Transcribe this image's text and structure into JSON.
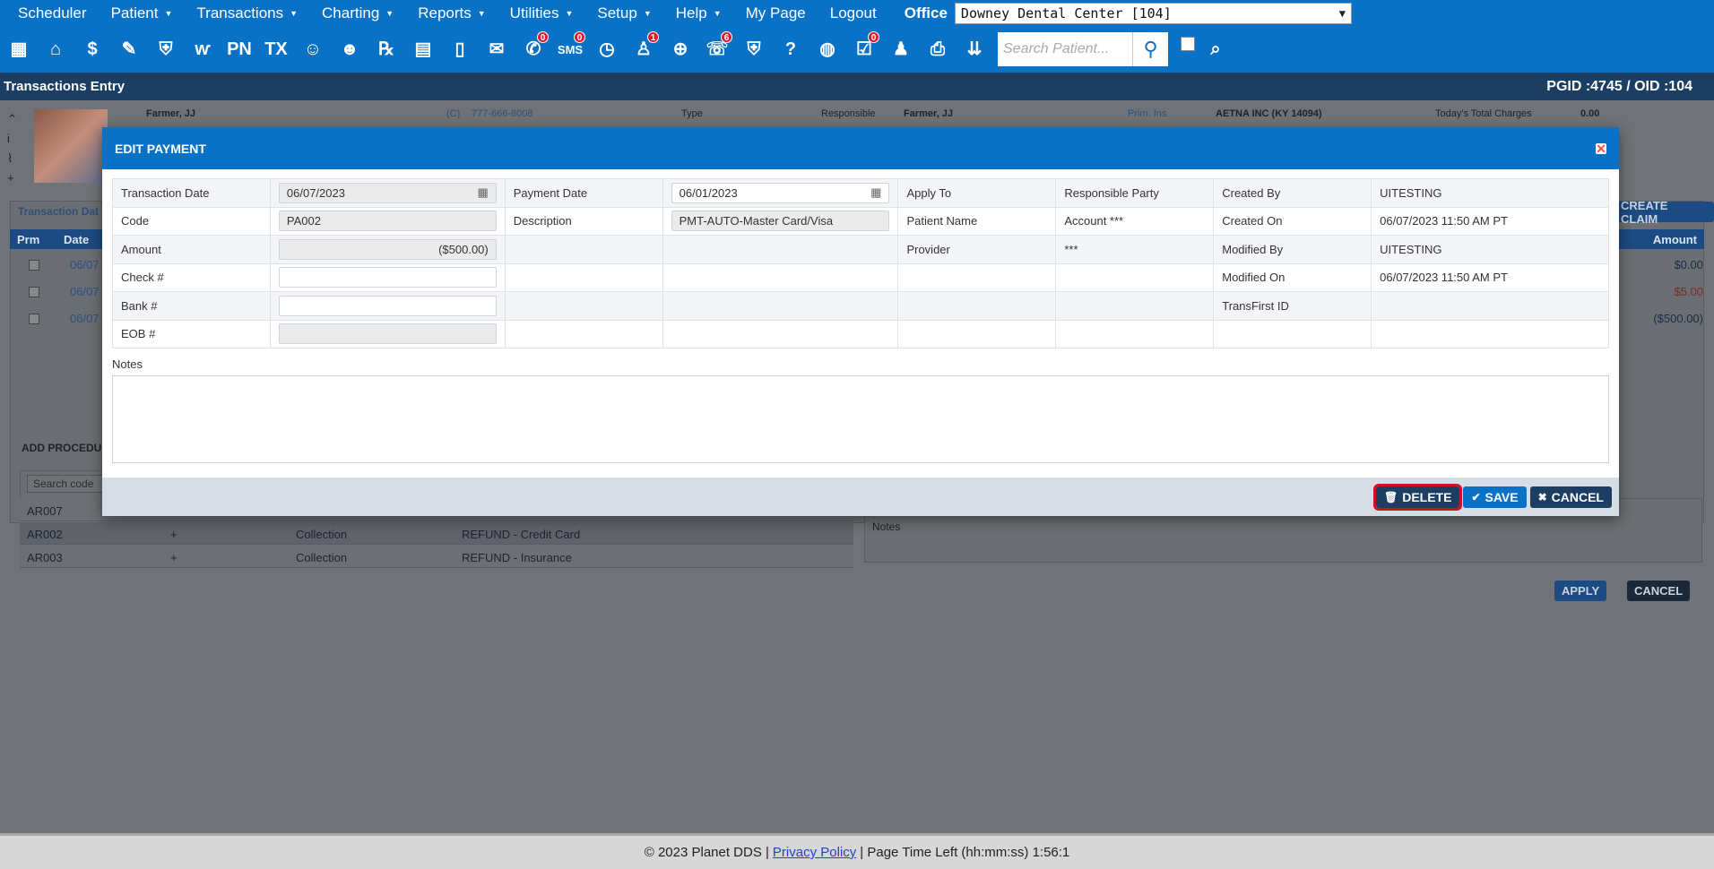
{
  "menu": {
    "items": [
      {
        "label": "Scheduler",
        "caret": false
      },
      {
        "label": "Patient",
        "caret": true
      },
      {
        "label": "Transactions",
        "caret": true
      },
      {
        "label": "Charting",
        "caret": true
      },
      {
        "label": "Reports",
        "caret": true
      },
      {
        "label": "Utilities",
        "caret": true
      },
      {
        "label": "Setup",
        "caret": true
      },
      {
        "label": "Help",
        "caret": true
      },
      {
        "label": "My Page",
        "caret": false
      },
      {
        "label": "Logout",
        "caret": false
      }
    ],
    "office_label": "Office",
    "office_value": "Downey Dental Center [104]"
  },
  "toolbar": {
    "icons": [
      {
        "name": "calendar-icon",
        "glyph": "▦"
      },
      {
        "name": "home-icon",
        "glyph": "⌂"
      },
      {
        "name": "dollar-transfer-icon",
        "glyph": "$"
      },
      {
        "name": "edit-pencil-icon",
        "glyph": "✎"
      },
      {
        "name": "tooth-chart-icon",
        "glyph": "⛨"
      },
      {
        "name": "perio-tooth-icon",
        "glyph": "ⱳ"
      },
      {
        "name": "progress-notes-icon",
        "glyph": "PN"
      },
      {
        "name": "treatment-plan-icon",
        "glyph": "TX"
      },
      {
        "name": "add-patient-icon",
        "glyph": "☺"
      },
      {
        "name": "add-family-icon",
        "glyph": "☻"
      },
      {
        "name": "prescription-icon",
        "glyph": "℞"
      },
      {
        "name": "note-icon",
        "glyph": "▤"
      },
      {
        "name": "document-icon",
        "glyph": "▯"
      },
      {
        "name": "mail-icon",
        "glyph": "✉"
      },
      {
        "name": "chat-icon",
        "glyph": "✆",
        "badge": "0"
      },
      {
        "name": "sms-icon",
        "glyph": "SMS",
        "badge": "0"
      },
      {
        "name": "clock-icon",
        "glyph": "◷"
      },
      {
        "name": "users-alert-icon",
        "glyph": "♙",
        "badge": "1"
      },
      {
        "name": "globe-user-icon",
        "glyph": "⊕"
      },
      {
        "name": "support-user-icon",
        "glyph": "☏",
        "badge": "6"
      },
      {
        "name": "tooth-icon",
        "glyph": "⛨"
      },
      {
        "name": "tooth-question-icon",
        "glyph": "?"
      },
      {
        "name": "web-globe-icon",
        "glyph": "◍"
      },
      {
        "name": "document-check-icon",
        "glyph": "☑",
        "badge": "0"
      },
      {
        "name": "family-icon",
        "glyph": "♟"
      },
      {
        "name": "printer-icon",
        "glyph": "⎙"
      },
      {
        "name": "download-chevrons-icon",
        "glyph": "⇊"
      }
    ],
    "search_placeholder": "Search Patient..."
  },
  "title": {
    "text": "Transactions Entry",
    "ids": "PGID :4745  /  OID :104"
  },
  "background": {
    "patient_name": "Farmer, JJ",
    "phone_label": "(C)",
    "phone": "777-666-8008",
    "type_label": "Type",
    "responsible_label": "Responsible",
    "responsible_value": "Farmer, JJ",
    "prim_ins_label": "Prim. Ins",
    "prim_ins_value": "AETNA INC (KY 14094)",
    "total_charges_label": "Today's Total Charges",
    "total_charges_value": "0.00",
    "transaction_date_label": "Transaction Dat",
    "create_claim": "CREATE CLAIM",
    "head_prm": "Prm",
    "head_date": "Date",
    "head_amount": "Amount",
    "rows": [
      {
        "date": "06/07",
        "amount": "$0.00"
      },
      {
        "date": "06/07",
        "amount": "$5.00"
      },
      {
        "date": "06/07",
        "amount": "($500.00)"
      }
    ],
    "add_procedure": "ADD PROCEDU",
    "search_code": "Search code",
    "codes": [
      {
        "code": "AR007",
        "plus": "",
        "type": "",
        "desc": ""
      },
      {
        "code": "AR002",
        "plus": "+",
        "type": "Collection",
        "desc": "REFUND - Credit Card"
      },
      {
        "code": "AR003",
        "plus": "+",
        "type": "Collection",
        "desc": "REFUND - Insurance"
      }
    ],
    "notes_label": "Notes",
    "apply": "APPLY",
    "cancel": "CANCEL"
  },
  "modal": {
    "title": "EDIT PAYMENT",
    "fields": {
      "transaction_date_label": "Transaction Date",
      "transaction_date": "06/07/2023",
      "payment_date_label": "Payment Date",
      "payment_date": "06/01/2023",
      "apply_to_label": "Apply To",
      "apply_to": "Responsible Party",
      "created_by_label": "Created By",
      "created_by": "UITESTING",
      "code_label": "Code",
      "code": "PA002",
      "description_label": "Description",
      "description": "PMT-AUTO-Master Card/Visa",
      "patient_name_label": "Patient Name",
      "patient_name": "Account ***",
      "created_on_label": "Created On",
      "created_on": "06/07/2023 11:50 AM PT",
      "amount_label": "Amount",
      "amount": "($500.00)",
      "provider_label": "Provider",
      "provider": "***",
      "modified_by_label": "Modified By",
      "modified_by": "UITESTING",
      "check_label": "Check #",
      "check": "",
      "modified_on_label": "Modified On",
      "modified_on": "06/07/2023 11:50 AM PT",
      "bank_label": "Bank #",
      "bank": "",
      "transfirst_label": "TransFirst ID",
      "transfirst": "",
      "eob_label": "EOB #",
      "eob": ""
    },
    "notes_label": "Notes",
    "notes": "",
    "buttons": {
      "delete": "DELETE",
      "save": "SAVE",
      "cancel": "CANCEL"
    }
  },
  "footer": {
    "copyright": "© 2023 Planet DDS |",
    "privacy": "Privacy Policy",
    "time_left": "|  Page Time Left (hh:mm:ss) 1:56:1"
  },
  "colors": {
    "primary": "#0a72c6",
    "dark": "#1c3e63",
    "badge": "#e2192c",
    "delete_outline": "#d0121f"
  }
}
